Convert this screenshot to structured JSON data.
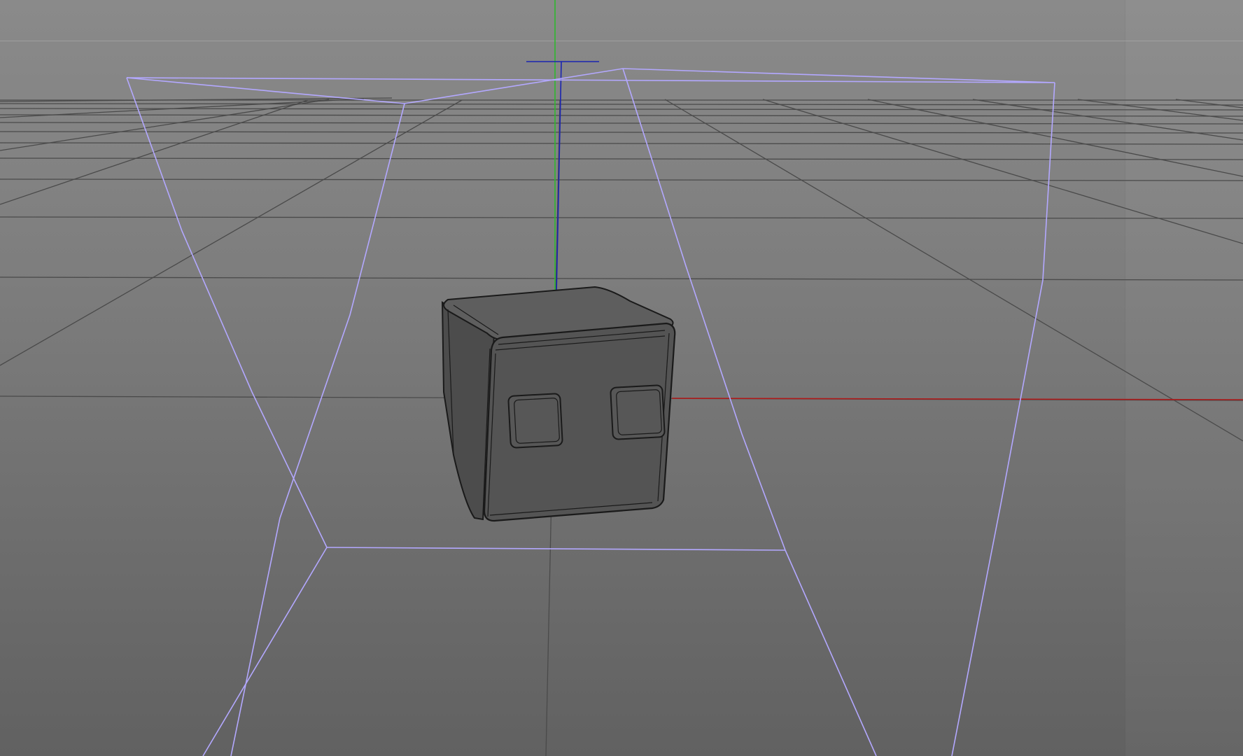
{
  "viewport": {
    "background_top": "#8a8a8a",
    "background_bottom": "#616161"
  },
  "colors": {
    "grid_line": "#4a4a4a",
    "bounding_box": "#b3a8ff",
    "axis_x": "#b01818",
    "axis_y": "#2eb82e",
    "axis_z": "#1a24b0",
    "object_fill": "#545454",
    "object_top": "#5e5e5e",
    "object_edge": "#1a1a1a"
  },
  "objects": [
    {
      "name": "rounded-cube",
      "icon": "cube-icon",
      "features": [
        "left-window",
        "right-window"
      ]
    }
  ]
}
